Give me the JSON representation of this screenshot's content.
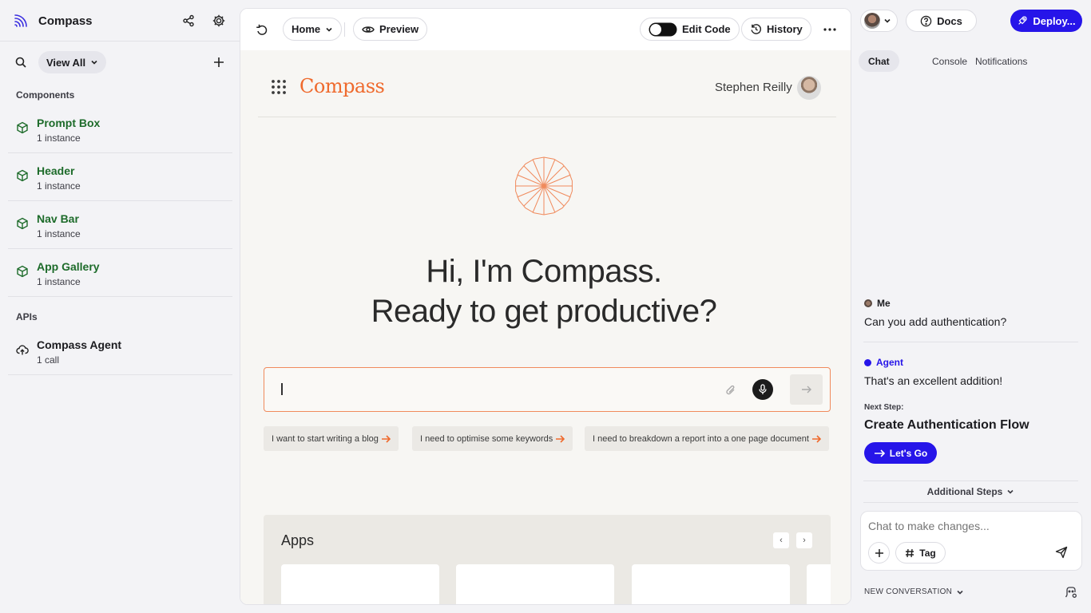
{
  "sidebar": {
    "app_name": "Compass",
    "view_all": "View All",
    "components_title": "Components",
    "components": [
      {
        "name": "Prompt Box",
        "sub": "1 instance"
      },
      {
        "name": "Header",
        "sub": "1 instance"
      },
      {
        "name": "Nav Bar",
        "sub": "1 instance"
      },
      {
        "name": "App Gallery",
        "sub": "1 instance"
      }
    ],
    "apis_title": "APIs",
    "apis": [
      {
        "name": "Compass Agent",
        "sub": "1 call"
      }
    ]
  },
  "toolbar": {
    "page": "Home",
    "preview": "Preview",
    "edit_code": "Edit Code",
    "history": "History"
  },
  "canvas": {
    "logo": "Compass",
    "user": "Stephen Reilly",
    "hero_line1": "Hi, I'm Compass.",
    "hero_line2": "Ready to get productive?",
    "suggestions": [
      "I want to start writing  a blog",
      "I need to optimise some keywords",
      "I need to breakdown a report into a one page document"
    ],
    "apps_title": "Apps"
  },
  "right": {
    "docs": "Docs",
    "deploy": "Deploy...",
    "tabs": [
      "Chat",
      "Console",
      "Notifications"
    ],
    "me_label": "Me",
    "me_message": "Can you add authentication?",
    "agent_label": "Agent",
    "agent_message": "That's an excellent addition!",
    "next_step_label": "Next Step:",
    "next_step_title": "Create Authentication Flow",
    "lets_go": "Let's Go",
    "additional_steps": "Additional Steps",
    "chat_placeholder": "Chat to make changes...",
    "tag": "Tag",
    "new_conversation": "NEW CONVERSATION"
  },
  "colors": {
    "accent": "#2615e9",
    "brand_orange": "#ef6a2d",
    "component_green": "#1d6b2a"
  }
}
